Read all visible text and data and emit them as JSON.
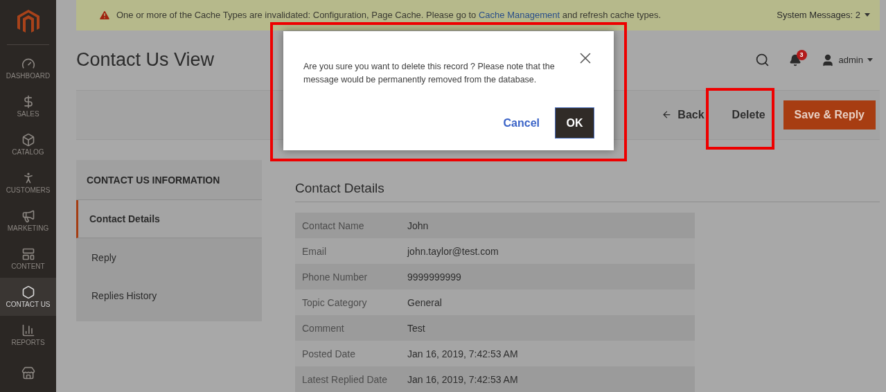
{
  "sidebar": {
    "items": [
      {
        "kind": "dashboard",
        "label": "DASHBOARD",
        "selected": false
      },
      {
        "kind": "sales",
        "label": "SALES",
        "selected": false
      },
      {
        "kind": "catalog",
        "label": "CATALOG",
        "selected": false
      },
      {
        "kind": "customers",
        "label": "CUSTOMERS",
        "selected": false
      },
      {
        "kind": "marketing",
        "label": "MARKETING",
        "selected": false
      },
      {
        "kind": "content",
        "label": "CONTENT",
        "selected": false
      },
      {
        "kind": "contact",
        "label": "CONTACT US",
        "selected": true
      },
      {
        "kind": "reports",
        "label": "REPORTS",
        "selected": false
      },
      {
        "kind": "stores",
        "selected": false
      }
    ]
  },
  "notice": {
    "text": "One or more of the Cache Types are invalidated: Configuration, Page Cache. Please go to",
    "link": "Cache Management",
    "after": "and refresh cache types.",
    "system_messages": "System Messages: 2"
  },
  "header": {
    "title": "Contact Us View",
    "notifications": "3",
    "user": "admin"
  },
  "actions": {
    "back": "Back",
    "delete": "Delete",
    "save": "Save & Reply"
  },
  "panel": {
    "title": "CONTACT US INFORMATION",
    "tabs": [
      {
        "label": "Contact Details",
        "selected": true
      },
      {
        "label": "Reply",
        "selected": false
      },
      {
        "label": "Replies History",
        "selected": false
      }
    ]
  },
  "details": {
    "title": "Contact Details",
    "rows": [
      {
        "label": "Contact Name",
        "value": "John"
      },
      {
        "label": "Email",
        "value": "john.taylor@test.com"
      },
      {
        "label": "Phone Number",
        "value": "9999999999"
      },
      {
        "label": "Topic Category",
        "value": "General"
      },
      {
        "label": "Comment",
        "value": "Test"
      },
      {
        "label": "Posted Date",
        "value": "Jan 16, 2019, 7:42:53 AM"
      },
      {
        "label": "Latest Replied Date",
        "value": "Jan 16, 2019, 7:42:53 AM"
      }
    ]
  },
  "modal": {
    "message": "Are you sure you want to delete this record ? Please note that the message would be permanently removed from the database.",
    "cancel": "Cancel",
    "ok": "OK"
  }
}
